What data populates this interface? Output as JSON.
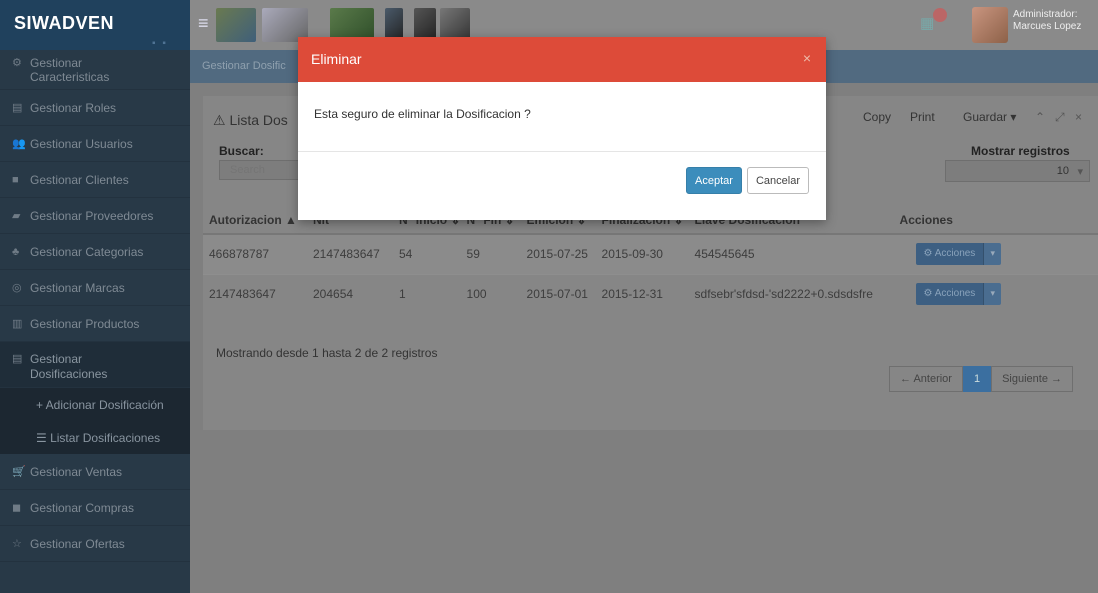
{
  "app": {
    "brand": "SIWADVEN"
  },
  "header": {
    "user_name_line1": "Administrador:",
    "user_name_line2": "Marcues Lopez"
  },
  "sidebar": {
    "items": [
      {
        "label": "Gestionar Caracteristicas",
        "icon": "gears-icon"
      },
      {
        "label": "Gestionar Roles",
        "icon": "list-icon"
      },
      {
        "label": "Gestionar Usuarios",
        "icon": "users-icon"
      },
      {
        "label": "Gestionar Clientes",
        "icon": "clients-icon"
      },
      {
        "label": "Gestionar Proveedores",
        "icon": "truck-icon"
      },
      {
        "label": "Gestionar Categorias",
        "icon": "sitemap-icon"
      },
      {
        "label": "Gestionar Marcas",
        "icon": "tag-icon"
      },
      {
        "label": "Gestionar Productos",
        "icon": "archive-icon"
      },
      {
        "label": "Gestionar Dosificaciones",
        "icon": "file-icon"
      }
    ],
    "sub_items": [
      {
        "label": "+ Adicionar Dosificación"
      },
      {
        "label": "☰ Listar Dosificaciones"
      }
    ],
    "items_after": [
      {
        "label": "Gestionar Ventas",
        "icon": "cart-icon"
      },
      {
        "label": "Gestionar Compras",
        "icon": "bag-icon"
      },
      {
        "label": "Gestionar Ofertas",
        "icon": "star-icon"
      }
    ]
  },
  "breadcrumb": {
    "text": "Gestionar Dosific"
  },
  "box": {
    "title": "Lista Dos",
    "tools": {
      "copy": "Copy",
      "print": "Print",
      "save": "Guardar ▾"
    },
    "search_label": "Buscar:",
    "search_placeholder": "Search",
    "show_label": "Mostrar registros",
    "show_value": "10"
  },
  "table": {
    "columns": [
      "Autorizacion ▲",
      "Nit",
      "N° Inicio ⇕",
      "N° Fin ⇕",
      "Emicion ⇕",
      "Finalizacion ⇕",
      "Llave Dosificacion",
      "Acciones"
    ],
    "rows": [
      [
        "466878787",
        "2147483647",
        "54",
        "59",
        "2015-07-25",
        "2015-09-30",
        "454545645"
      ],
      [
        "2147483647",
        "204654",
        "1",
        "100",
        "2015-07-01",
        "2015-12-31",
        "sdfsebr'sfdsd-'sd2222+0.sdsdsfre"
      ]
    ],
    "action_label": "Acciones"
  },
  "footer": {
    "info": "Mostrando desde 1 hasta 2 de 2 registros",
    "prev": "← Anterior",
    "page": "1",
    "next": "Siguiente →"
  },
  "modal": {
    "title": "Eliminar",
    "close": "×",
    "message": "Esta seguro de eliminar la Dosificacion ?",
    "accept": "Aceptar",
    "cancel": "Cancelar",
    "header_color": "#dd4b39",
    "accept_color": "#3c8dbc"
  }
}
